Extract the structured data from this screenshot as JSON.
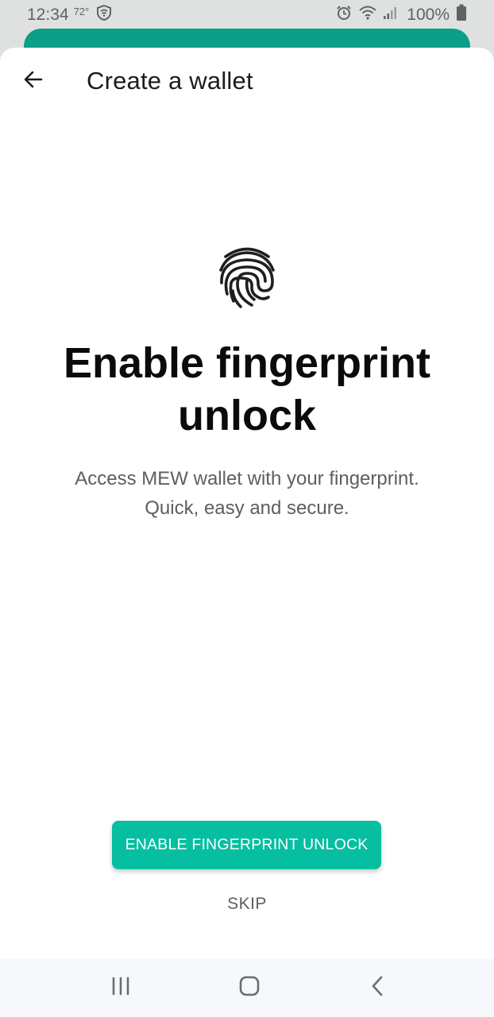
{
  "status_bar": {
    "time": "12:34",
    "temperature": "72°",
    "battery": "100%",
    "icons": [
      "shield-icon",
      "alarm-icon",
      "wifi-icon",
      "signal-icon",
      "battery-icon"
    ]
  },
  "header": {
    "back_icon": "arrow-left-icon",
    "title": "Create a wallet"
  },
  "main": {
    "icon": "fingerprint-icon",
    "headline": "Enable fingerprint unlock",
    "description_line1": "Access MEW wallet with your fingerprint.",
    "description_line2": "Quick, easy and secure."
  },
  "actions": {
    "primary_label": "ENABLE FINGERPRINT UNLOCK",
    "skip_label": "SKIP"
  },
  "nav_bar": {
    "icons": [
      "recents-icon",
      "home-icon",
      "back-icon"
    ]
  },
  "colors": {
    "accent": "#05bfa0",
    "header_sheet": "#0c9e86",
    "text_primary": "#0b0b0c",
    "text_secondary": "#5c5e63"
  }
}
